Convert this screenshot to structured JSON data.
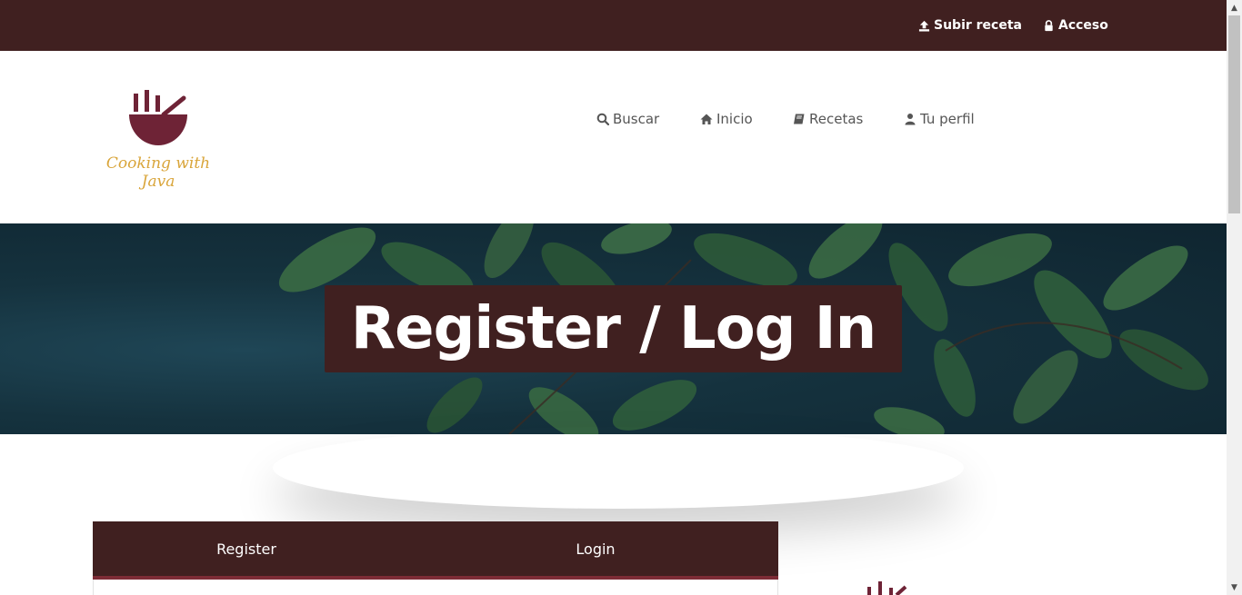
{
  "topbar": {
    "upload_label": "Subir receta",
    "access_label": "Acceso"
  },
  "logo": {
    "text": "Cooking with Java"
  },
  "nav": {
    "items": [
      {
        "label": "Buscar",
        "icon": "search-icon"
      },
      {
        "label": "Inicio",
        "icon": "home-icon"
      },
      {
        "label": "Recetas",
        "icon": "book-icon"
      },
      {
        "label": "Tu perfil",
        "icon": "user-icon"
      }
    ]
  },
  "hero": {
    "title": "Register / Log In"
  },
  "tabs": {
    "items": [
      {
        "label": "Register"
      },
      {
        "label": "Login"
      }
    ]
  },
  "colors": {
    "brand_dark": "#402020",
    "brand_accent": "#7d2c36",
    "logo_gold": "#d9a53a",
    "logo_bowl": "#6e2336"
  }
}
